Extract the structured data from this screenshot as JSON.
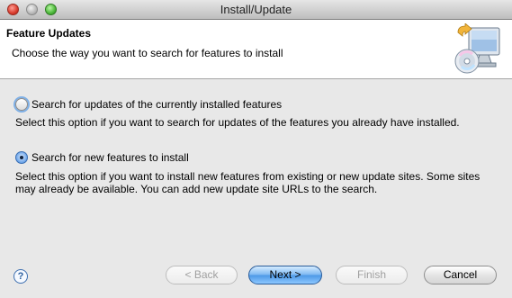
{
  "window": {
    "title": "Install/Update"
  },
  "banner": {
    "title": "Feature Updates",
    "description": "Choose the way you want to search for features to install"
  },
  "options": [
    {
      "label": "Search for updates of the currently installed features",
      "description": "Select this option if you want to search for updates of the features you already have installed.",
      "checked": false
    },
    {
      "label": "Search for new features to install",
      "description": "Select this option if you want to install new features from existing or new update sites. Some sites may already be available. You can add new update site URLs to the search.",
      "checked": true
    }
  ],
  "footer": {
    "help_symbol": "?",
    "back_label": "< Back",
    "next_label": "Next >",
    "finish_label": "Finish",
    "cancel_label": "Cancel"
  },
  "icons": {
    "help": "help-icon",
    "banner": "install-wizard-icon"
  }
}
